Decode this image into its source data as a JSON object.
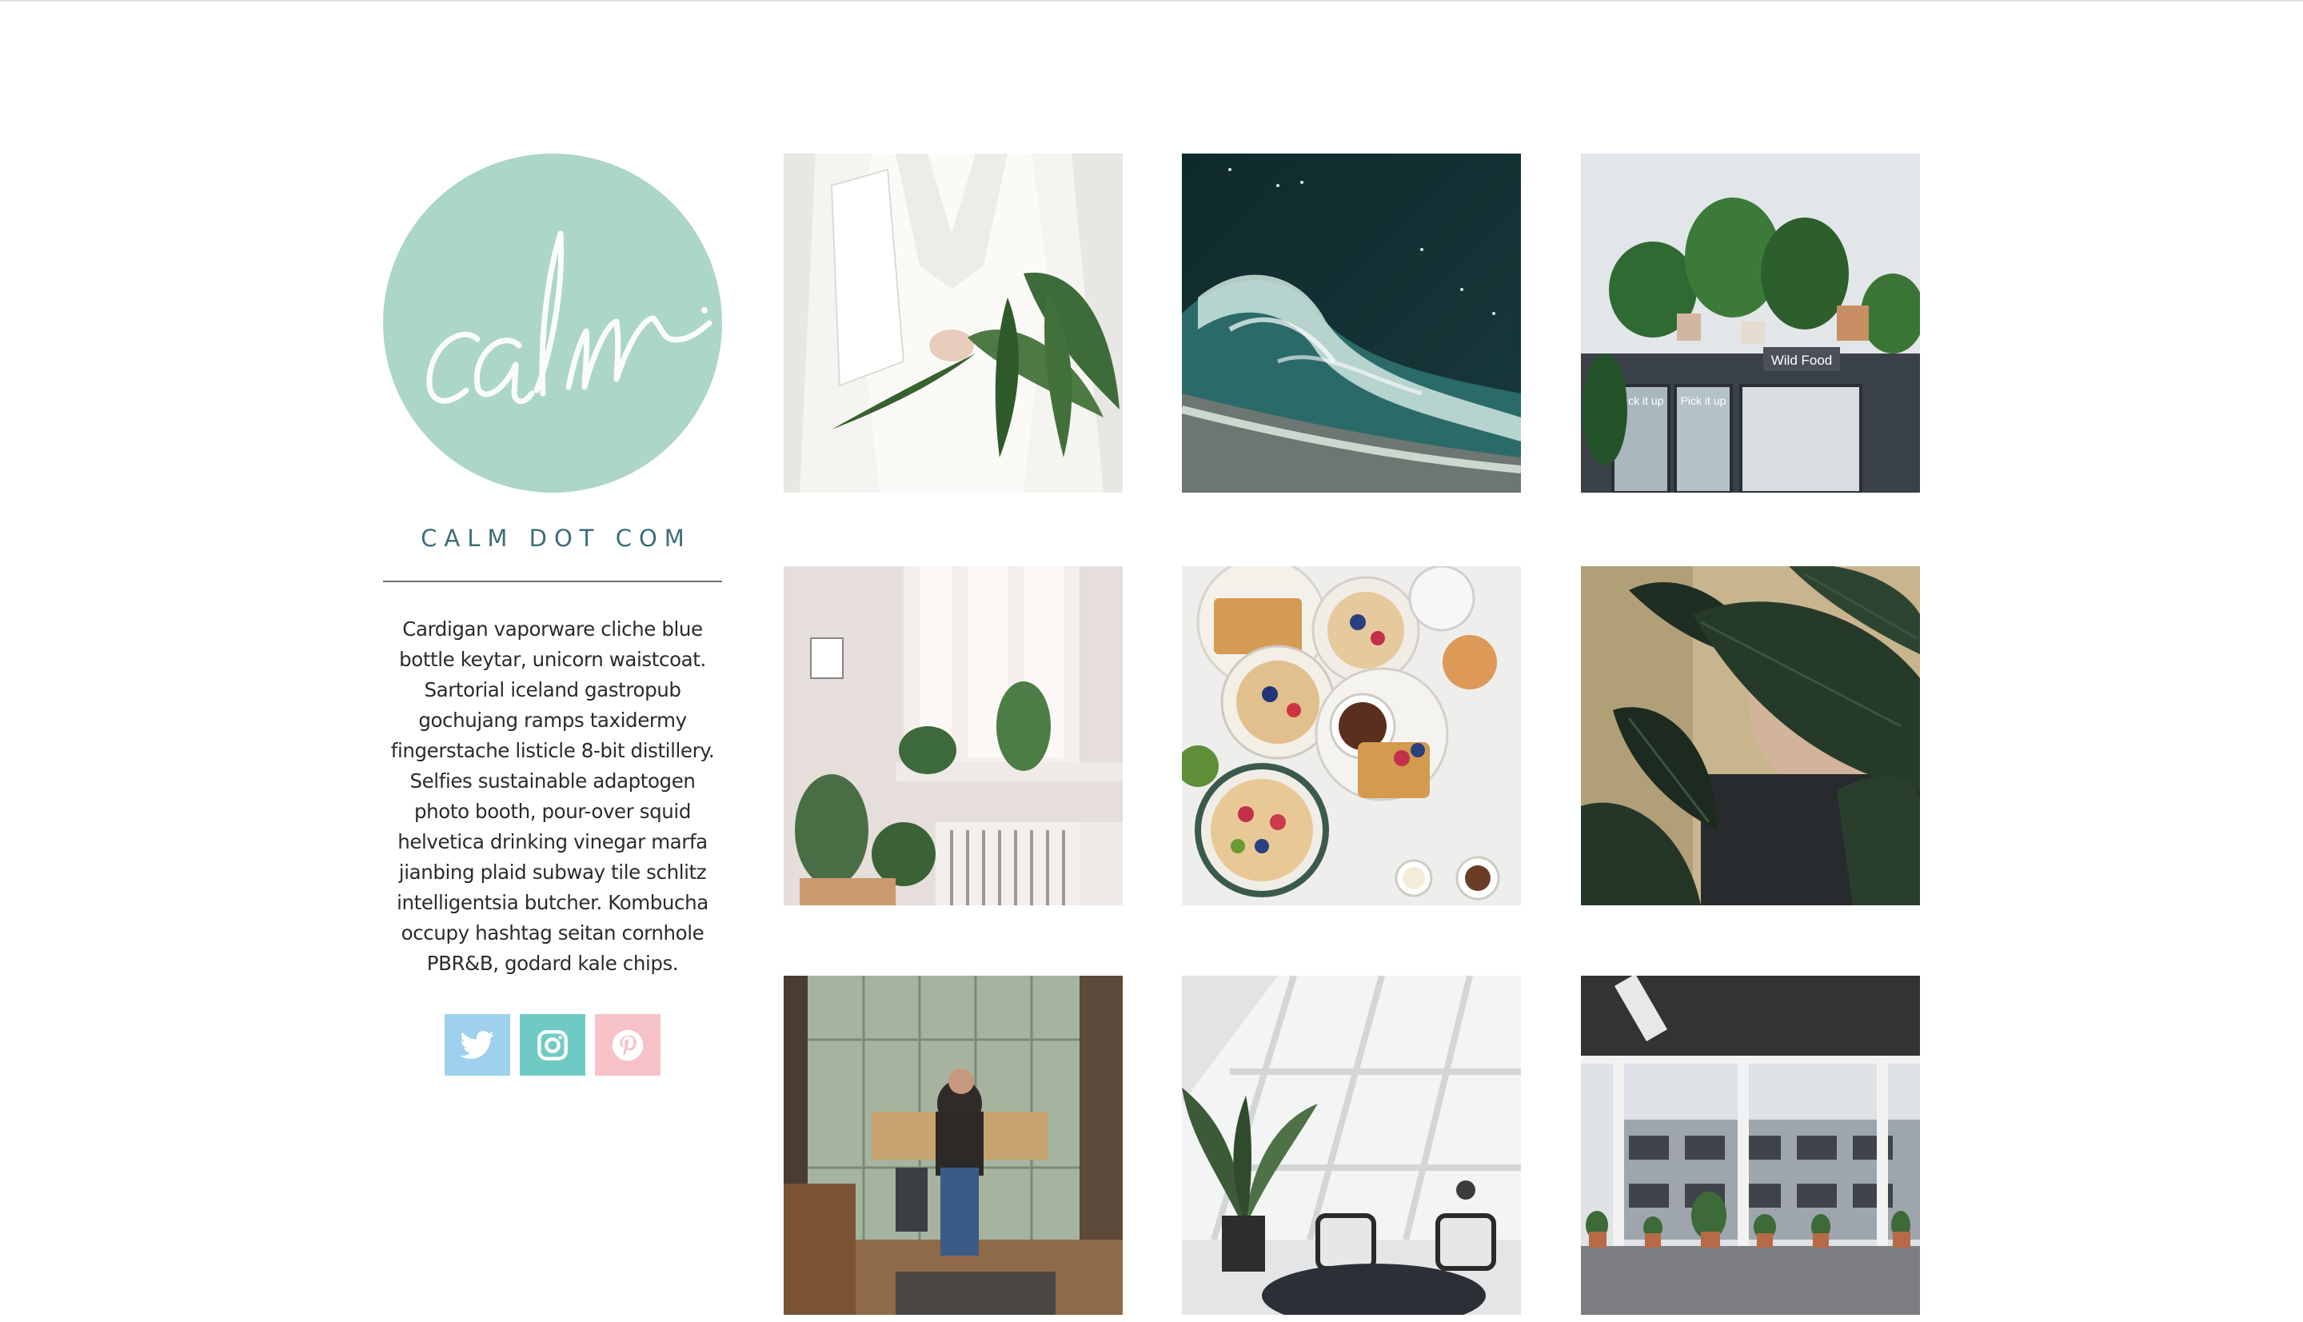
{
  "sidebar": {
    "logo_text": "calm.",
    "title": "CALM DOT COM",
    "bio": "Cardigan vaporware cliche blue bottle keytar, unicorn waistcoat. Sartorial iceland gastropub gochujang ramps taxidermy fingerstache listicle 8-bit distillery. Selfies sustainable adaptogen photo booth, pour-over squid helvetica drinking vinegar marfa jianbing plaid subway tile schlitz intelligentsia butcher. Kombucha occupy hashtag seitan cornhole PBR&B, godard kale chips.",
    "social": [
      {
        "icon": "twitter-icon",
        "color": "#9fd1ef"
      },
      {
        "icon": "instagram-icon",
        "color": "#6fcac4"
      },
      {
        "icon": "pinterest-icon",
        "color": "#f6c2c8"
      }
    ]
  },
  "colors": {
    "logo_circle": "#acd6c7",
    "title": "#3c6e78",
    "text": "#2b2b2b"
  },
  "gallery": {
    "photo_signs": {
      "pick_it_up_1": "Pick it up",
      "pick_it_up_2": "Pick it up",
      "wild_food": "Wild Food"
    }
  }
}
